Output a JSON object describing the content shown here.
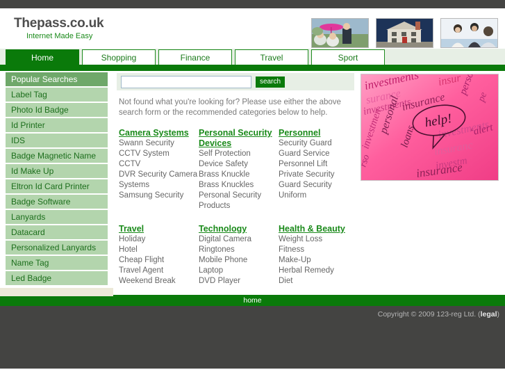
{
  "brand": {
    "title": "Thepass.co.uk",
    "tagline": "Internet Made Easy"
  },
  "header_images": [
    {
      "name": "couple-umbrella-photo",
      "alt": "Couple under pink umbrella"
    },
    {
      "name": "house-photo",
      "alt": "White house at dusk"
    },
    {
      "name": "business-meeting-photo",
      "alt": "Business people meeting"
    }
  ],
  "nav": {
    "tabs": [
      {
        "label": "Home",
        "active": true
      },
      {
        "label": "Shopping",
        "active": false
      },
      {
        "label": "Finance",
        "active": false
      },
      {
        "label": "Travel",
        "active": false
      },
      {
        "label": "Sport",
        "active": false
      }
    ]
  },
  "sidebar": {
    "heading": "Popular Searches",
    "items": [
      "Label Tag",
      "Photo Id Badge",
      "Id Printer",
      "IDS",
      "Badge Magnetic Name",
      "Id Make Up",
      "Eltron Id Card Printer",
      "Badge Software",
      "Lanyards",
      "Datacard",
      "Personalized Lanyards",
      "Name Tag",
      "Led Badge"
    ]
  },
  "search": {
    "value": "",
    "placeholder": "",
    "button_label": "search"
  },
  "blurb": "Not found what you're looking for? Please use either the above search form or the recommended categories below to help.",
  "categories": [
    {
      "title": "Camera Systems",
      "items": [
        "Swann Security",
        "CCTV System",
        "CCTV",
        "DVR Security Camera Systems",
        "Samsung Security"
      ]
    },
    {
      "title": "Personal Security Devices",
      "items": [
        "Self Protection",
        "Device Safety",
        "Brass Knuckle",
        "Brass Knuckles",
        "Personal Security Products"
      ]
    },
    {
      "title": "Personnel",
      "items": [
        "Security Guard",
        "Guard Service",
        "Personnel Lift",
        "Private Security",
        "Guard Security Uniform"
      ]
    },
    {
      "title": "Travel",
      "items": [
        "Holiday",
        "Hotel",
        "Cheap Flight",
        "Travel Agent",
        "Weekend Break"
      ]
    },
    {
      "title": "Technology",
      "items": [
        "Digital Camera",
        "Ringtones",
        "Mobile Phone",
        "Laptop",
        "DVD Player"
      ]
    },
    {
      "title": "Health & Beauty",
      "items": [
        "Weight Loss",
        "Fitness",
        "Make-Up",
        "Herbal Remedy",
        "Diet"
      ]
    }
  ],
  "promo": {
    "name": "insurance-help-image",
    "words": [
      "insurance",
      "investments",
      "personal",
      "loans",
      "help!"
    ]
  },
  "footer": {
    "home_label": "home",
    "copyright_text": "Copyright © 2009 123-reg Ltd. (",
    "legal_label": "legal",
    "copyright_suffix": ")"
  },
  "colors": {
    "accent_green": "#0a7a0a",
    "light_green": "#b3d5ad",
    "dark_bar": "#444442",
    "pale_green": "#e7efe5"
  }
}
